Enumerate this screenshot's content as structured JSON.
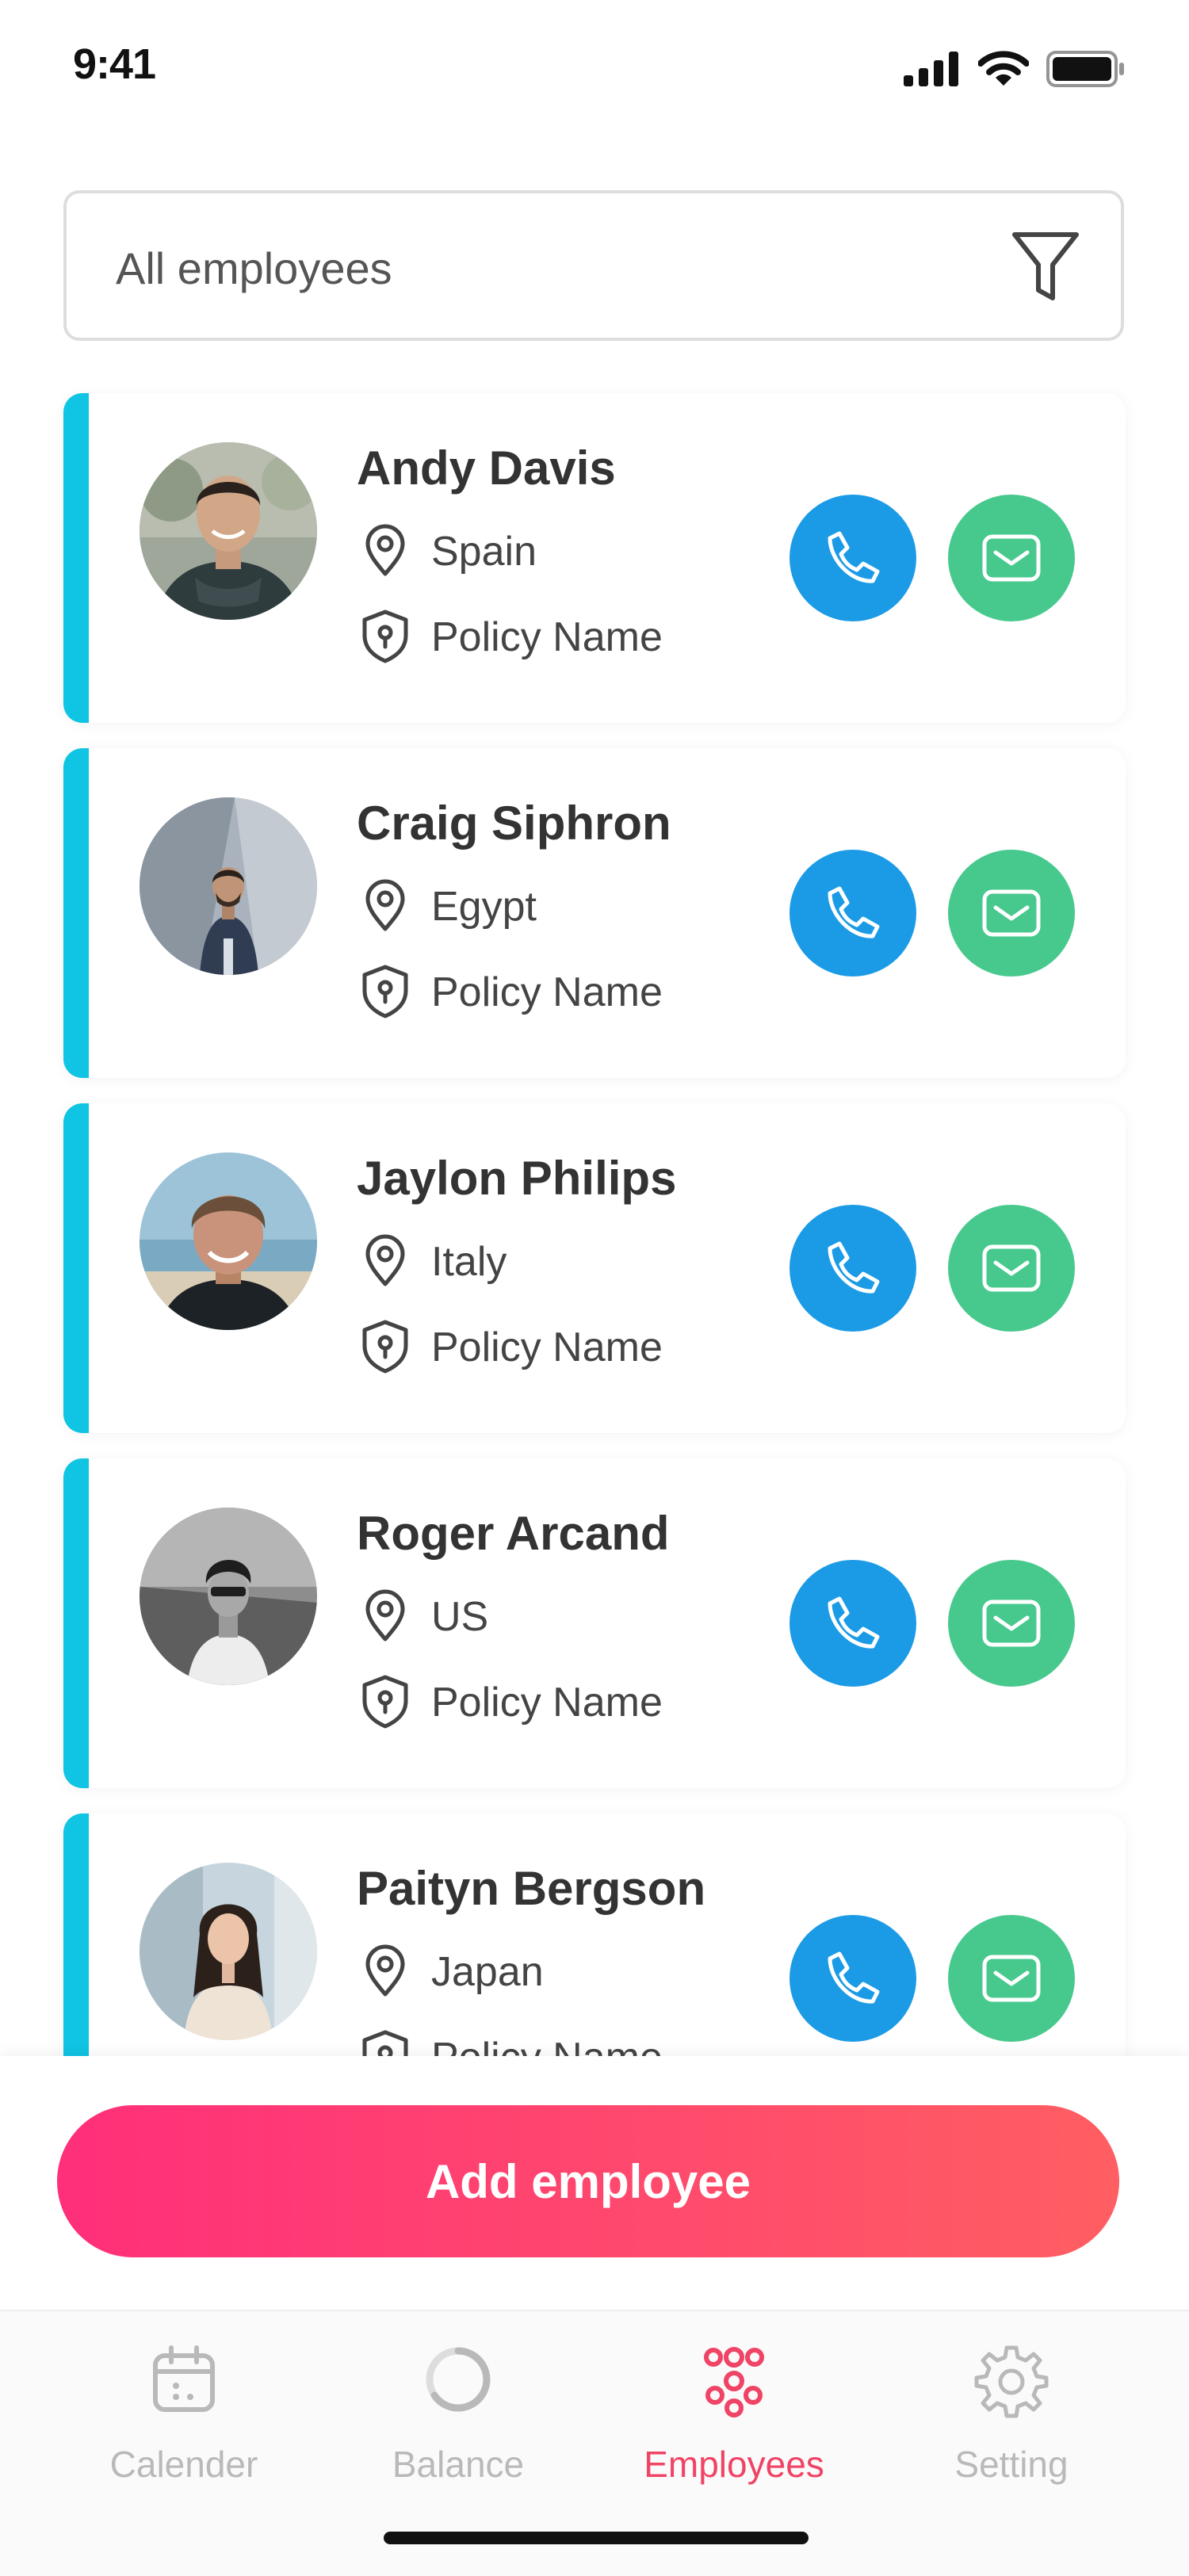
{
  "status_bar": {
    "time": "9:41"
  },
  "filter": {
    "label": "All employees",
    "icon": "filter-icon"
  },
  "employees": [
    {
      "name": "Andy Davis",
      "country": "Spain",
      "policy": "Policy Name"
    },
    {
      "name": "Craig Siphron",
      "country": "Egypt",
      "policy": "Policy Name"
    },
    {
      "name": "Jaylon Philips",
      "country": "Italy",
      "policy": "Policy Name"
    },
    {
      "name": "Roger Arcand",
      "country": "US",
      "policy": "Policy Name"
    },
    {
      "name": "Paityn Bergson",
      "country": "Japan",
      "policy": "Policy Name"
    }
  ],
  "actions": {
    "add_label": "Add employee"
  },
  "tabs": [
    {
      "label": "Calender",
      "icon": "calendar-icon"
    },
    {
      "label": "Balance",
      "icon": "balance-icon"
    },
    {
      "label": "Employees",
      "icon": "employees-icon",
      "active": true
    },
    {
      "label": "Setting",
      "icon": "settings-icon"
    }
  ],
  "colors": {
    "accent_bar": "#10c4e3",
    "call_button": "#1b9be6",
    "mail_button": "#47c98e",
    "primary_gradient_start": "#ff2f7a",
    "primary_gradient_end": "#ff5e62",
    "active_tab": "#f04466",
    "inactive_tab": "#b9b9b9"
  }
}
